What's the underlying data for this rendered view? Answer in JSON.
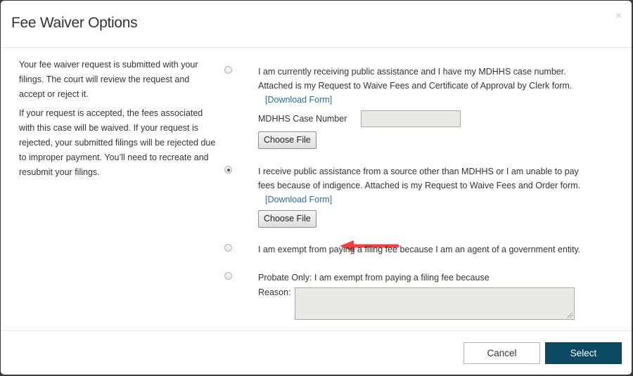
{
  "dialog": {
    "title": "Fee Waiver Options",
    "close_label": "×"
  },
  "intro": {
    "paragraph1": "Your fee waiver request is submitted with your filings. The court will review the request and accept or reject it.",
    "paragraph2": "If your request is accepted, the fees associated with this case will be waived. If your request is rejected, your submitted filings will be rejected due to  improper payment. You’ll need to recreate and resubmit your filings."
  },
  "options": [
    {
      "text": "I am currently receiving public assistance and I have my MDHHS case number. Attached is my Request to Waive Fees and Certificate of Approval by Clerk form.",
      "link": "[Download Form]",
      "case_label": "MDHHS Case Number",
      "case_value": "",
      "file_button": "Choose File",
      "selected": false
    },
    {
      "text": "I receive public assistance from a source other than MDHHS or I am unable to pay fees because of indigence. Attached is my Request to Waive Fees and Order form.",
      "link": "[Download Form]",
      "file_button": "Choose File",
      "selected": true
    },
    {
      "text": "I am exempt from paying a filing fee because I am an agent of a government entity.",
      "selected": false
    },
    {
      "text": "Probate Only: I am exempt from paying a filing fee because",
      "reason_label": "Reason:",
      "reason_value": "",
      "selected": false
    }
  ],
  "annotation": {
    "arrow_color": "#f04040",
    "arrow_target": "option 2 download form link"
  },
  "footer": {
    "cancel_label": "Cancel",
    "select_label": "Select"
  },
  "colors": {
    "primary": "#0c4a63",
    "link": "#2a6ea6"
  }
}
